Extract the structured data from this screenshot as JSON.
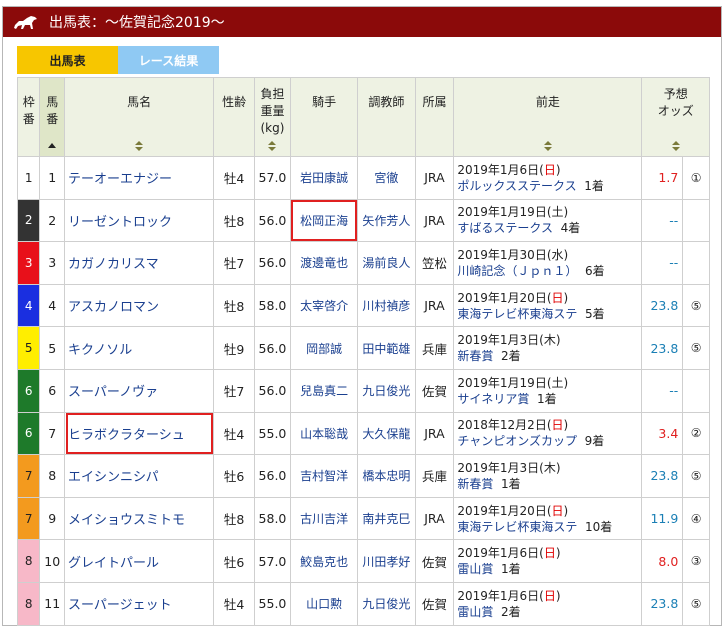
{
  "header": {
    "title": "出馬表：～佐賀記念2019～"
  },
  "tabs": [
    {
      "label": "出馬表",
      "active": true
    },
    {
      "label": "レース結果",
      "active": false
    }
  ],
  "columns": {
    "waku": "枠番",
    "umaban": "馬番",
    "name": "馬名",
    "sexage": "性齢",
    "weight1": "負担",
    "weight2": "重量",
    "weight3": "(kg)",
    "jockey": "騎手",
    "trainer": "調教師",
    "belong": "所属",
    "prev": "前走",
    "odds1": "予想",
    "odds2": "オッズ"
  },
  "colors": {
    "header_bg": "#8b0a0a",
    "tab_active": "#f7c600",
    "tab_inactive": "#8fc9f3",
    "odds_blue": "#1a7fb5",
    "odds_red": "#e02020",
    "highlight_box": "#e02020"
  },
  "rows": [
    {
      "waku": "1",
      "waku_bg": "#ffffff",
      "waku_fg": "#222222",
      "umaban": "1",
      "name": "テーオーエナジー",
      "sexage": "牡4",
      "weight": "57.0",
      "jockey": "岩田康誠",
      "trainer": "宮徹",
      "belong": "JRA",
      "prev_date": "2019年1月6日(",
      "prev_wd": "日",
      "prev_wd_red": true,
      "prev_race": "ポルックスステークス",
      "prev_result": "1着",
      "odds": "1.7",
      "odds_color": "red",
      "rank": "①"
    },
    {
      "waku": "2",
      "waku_bg": "#333333",
      "waku_fg": "#ffffff",
      "umaban": "2",
      "name": "リーゼントロック",
      "sexage": "牡8",
      "weight": "56.0",
      "jockey": "松岡正海",
      "trainer": "矢作芳人",
      "belong": "JRA",
      "prev_date": "2019年1月19日(",
      "prev_wd": "土",
      "prev_wd_red": false,
      "prev_race": "すばるステークス",
      "prev_result": "4着",
      "odds": "--",
      "odds_color": "blue",
      "rank": ""
    },
    {
      "waku": "3",
      "waku_bg": "#e8101a",
      "waku_fg": "#ffffff",
      "umaban": "3",
      "name": "カガノカリスマ",
      "sexage": "牡7",
      "weight": "56.0",
      "jockey": "渡邊竜也",
      "trainer": "湯前良人",
      "belong": "笠松",
      "prev_date": "2019年1月30日(",
      "prev_wd": "水",
      "prev_wd_red": false,
      "prev_race": "川崎記念（Ｊｐｎ１）",
      "prev_result": "6着",
      "odds": "--",
      "odds_color": "blue",
      "rank": ""
    },
    {
      "waku": "4",
      "waku_bg": "#1a2fe0",
      "waku_fg": "#ffffff",
      "umaban": "4",
      "name": "アスカノロマン",
      "sexage": "牡8",
      "weight": "58.0",
      "jockey": "太宰啓介",
      "trainer": "川村禎彦",
      "belong": "JRA",
      "prev_date": "2019年1月20日(",
      "prev_wd": "日",
      "prev_wd_red": true,
      "prev_race": "東海テレビ杯東海ステ",
      "prev_result": "5着",
      "odds": "23.8",
      "odds_color": "blue",
      "rank": "⑤"
    },
    {
      "waku": "5",
      "waku_bg": "#ffee00",
      "waku_fg": "#222222",
      "umaban": "5",
      "name": "キクノソル",
      "sexage": "牡9",
      "weight": "56.0",
      "jockey": "岡部誠",
      "trainer": "田中範雄",
      "belong": "兵庫",
      "prev_date": "2019年1月3日(",
      "prev_wd": "木",
      "prev_wd_red": false,
      "prev_race": "新春賞",
      "prev_result": "2着",
      "odds": "23.8",
      "odds_color": "blue",
      "rank": "⑤"
    },
    {
      "waku": "6",
      "waku_bg": "#1e7a2a",
      "waku_fg": "#ffffff",
      "umaban": "6",
      "name": "スーパーノヴァ",
      "sexage": "牡7",
      "weight": "56.0",
      "jockey": "兒島真二",
      "trainer": "九日俊光",
      "belong": "佐賀",
      "prev_date": "2019年1月19日(",
      "prev_wd": "土",
      "prev_wd_red": false,
      "prev_race": "サイネリア賞",
      "prev_result": "1着",
      "odds": "--",
      "odds_color": "blue",
      "rank": ""
    },
    {
      "waku": "6",
      "waku_bg": "#1e7a2a",
      "waku_fg": "#ffffff",
      "umaban": "7",
      "name": "ヒラボクラターシュ",
      "sexage": "牡4",
      "weight": "55.0",
      "jockey": "山本聡哉",
      "trainer": "大久保龍",
      "belong": "JRA",
      "prev_date": "2018年12月2日(",
      "prev_wd": "日",
      "prev_wd_red": true,
      "prev_race": "チャンピオンズカップ",
      "prev_result": "9着",
      "odds": "3.4",
      "odds_color": "red",
      "rank": "②"
    },
    {
      "waku": "7",
      "waku_bg": "#f39a1e",
      "waku_fg": "#222222",
      "umaban": "8",
      "name": "エイシンニシパ",
      "sexage": "牡6",
      "weight": "56.0",
      "jockey": "吉村智洋",
      "trainer": "橋本忠明",
      "belong": "兵庫",
      "prev_date": "2019年1月3日(",
      "prev_wd": "木",
      "prev_wd_red": false,
      "prev_race": "新春賞",
      "prev_result": "1着",
      "odds": "23.8",
      "odds_color": "blue",
      "rank": "⑤"
    },
    {
      "waku": "7",
      "waku_bg": "#f39a1e",
      "waku_fg": "#222222",
      "umaban": "9",
      "name": "メイショウスミトモ",
      "sexage": "牡8",
      "weight": "58.0",
      "jockey": "古川吉洋",
      "trainer": "南井克巳",
      "belong": "JRA",
      "prev_date": "2019年1月20日(",
      "prev_wd": "日",
      "prev_wd_red": true,
      "prev_race": "東海テレビ杯東海ステ",
      "prev_result": "10着",
      "odds": "11.9",
      "odds_color": "blue",
      "rank": "④"
    },
    {
      "waku": "8",
      "waku_bg": "#f7b8c8",
      "waku_fg": "#222222",
      "umaban": "10",
      "name": "グレイトパール",
      "sexage": "牡6",
      "weight": "57.0",
      "jockey": "鮫島克也",
      "trainer": "川田孝好",
      "belong": "佐賀",
      "prev_date": "2019年1月6日(",
      "prev_wd": "日",
      "prev_wd_red": true,
      "prev_race": "雷山賞",
      "prev_result": "1着",
      "odds": "8.0",
      "odds_color": "red",
      "rank": "③"
    },
    {
      "waku": "8",
      "waku_bg": "#f7b8c8",
      "waku_fg": "#222222",
      "umaban": "11",
      "name": "スーパージェット",
      "sexage": "牡4",
      "weight": "55.0",
      "jockey": "山口勲",
      "trainer": "九日俊光",
      "belong": "佐賀",
      "prev_date": "2019年1月6日(",
      "prev_wd": "日",
      "prev_wd_red": true,
      "prev_race": "雷山賞",
      "prev_result": "2着",
      "odds": "23.8",
      "odds_color": "blue",
      "rank": "⑤"
    }
  ],
  "highlighted": [
    {
      "row": 1,
      "col": "jockey"
    },
    {
      "row": 6,
      "col": "name"
    }
  ]
}
